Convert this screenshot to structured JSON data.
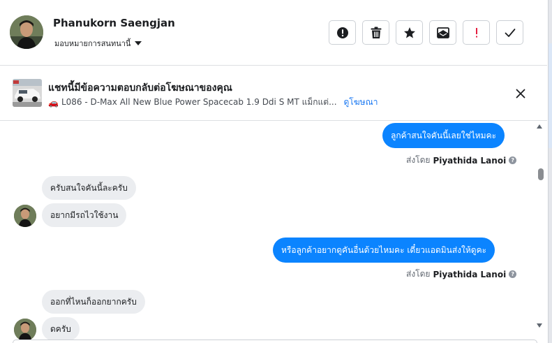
{
  "header": {
    "name": "Phanukorn Saengjan",
    "assign_label": "มอบหมายการสนทนานี้",
    "actions": [
      {
        "name": "report-spam-button",
        "icon": "exclamation-circle-icon"
      },
      {
        "name": "delete-button",
        "icon": "trash-icon"
      },
      {
        "name": "star-button",
        "icon": "star-icon"
      },
      {
        "name": "move-to-inbox-button",
        "icon": "archive-envelope-icon"
      },
      {
        "name": "follow-up-button",
        "icon": "exclamation-mark-icon"
      },
      {
        "name": "mark-done-button",
        "icon": "checkmark-icon"
      }
    ]
  },
  "ad": {
    "title": "แชทนี้มีข้อความตอบกลับต่อโฆษณาของคุณ",
    "car_emoji": "🚗",
    "description": "L086 - D-Max All New Blue Power Spacecab 1.9 Ddi S MT แม็กแต่...",
    "link_label": "ดูโฆษณา"
  },
  "messages": [
    {
      "dir": "out",
      "text": "ลูกค้าสนใจคันนี้เลยใช่ไหมคะ"
    },
    {
      "sent_by_prefix": "ส่งโดย",
      "sent_by_name": "Piyathida Lanoi"
    },
    {
      "dir": "in",
      "text": "ครับสนใจคันนี้ละครับ"
    },
    {
      "dir": "in",
      "text": "อยากมีรถไวใช้งาน"
    },
    {
      "dir": "out",
      "text": "หรือลูกค้าอยากดูคันอื่นด้วยไหมคะ เดี๋ยวแอดมินส่งให้ดูคะ"
    },
    {
      "sent_by_prefix": "ส่งโดย",
      "sent_by_name": "Piyathida Lanoi"
    },
    {
      "dir": "in",
      "text": "ออกที่ไหนก็ออกยากครับ"
    },
    {
      "dir": "in",
      "text": "ดครับ"
    }
  ],
  "colors": {
    "accent": "#0b84ff",
    "link": "#1877f2",
    "incoming_bubble": "#ebedf0",
    "follow_up_red": "#e41e3f"
  }
}
